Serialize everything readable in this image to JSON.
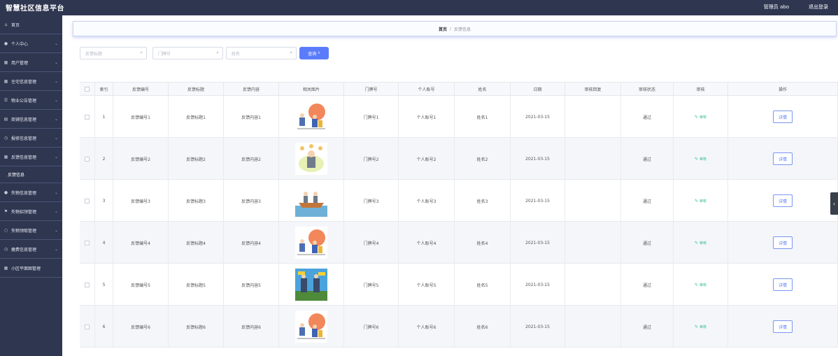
{
  "app": {
    "title": "智慧社区信息平台",
    "user_label": "管理员 abo",
    "logout_label": "退出登录"
  },
  "sidebar": {
    "items": [
      {
        "label": "首页",
        "icon": "home-icon",
        "glyph": "⌂"
      },
      {
        "label": "个人中心",
        "icon": "user-icon",
        "glyph": "●",
        "arrow": true
      },
      {
        "label": "用户管理",
        "icon": "grid-icon",
        "glyph": "▦",
        "arrow": true
      },
      {
        "label": "住宅信息管理",
        "icon": "grid-icon",
        "glyph": "▦",
        "arrow": true
      },
      {
        "label": "物业公告管理",
        "icon": "sliders-icon",
        "glyph": "☰",
        "arrow": true
      },
      {
        "label": "商铺信息管理",
        "icon": "building-icon",
        "glyph": "▤",
        "arrow": true
      },
      {
        "label": "报修信息管理",
        "icon": "clock-icon",
        "glyph": "◷",
        "arrow": true
      },
      {
        "label": "反馈信息管理",
        "icon": "grid-icon",
        "glyph": "▦",
        "arrow": true,
        "expanded": true
      },
      {
        "label": "反馈信息",
        "sub": true
      },
      {
        "label": "失物信息管理",
        "icon": "person-icon",
        "glyph": "●",
        "arrow": true
      },
      {
        "label": "失物招领管理",
        "icon": "flag-icon",
        "glyph": "⚑",
        "arrow": true
      },
      {
        "label": "失物领取管理",
        "icon": "circle-icon",
        "glyph": "○",
        "arrow": true
      },
      {
        "label": "缴费信息管理",
        "icon": "clock-icon",
        "glyph": "◷",
        "arrow": true
      },
      {
        "label": "小区平面图管理",
        "icon": "grid-icon",
        "glyph": "▦",
        "arrow": false
      }
    ]
  },
  "breadcrumb": {
    "home": "首页",
    "separator": "/",
    "current": "反馈信息"
  },
  "search": {
    "title_placeholder": "反馈标题",
    "door_placeholder": "门牌号",
    "name_placeholder": "姓名",
    "query_label": "查询"
  },
  "table": {
    "headers": [
      "索引",
      "反馈编号",
      "反馈标题",
      "反馈内容",
      "相关图片",
      "门牌号",
      "个人账号",
      "姓名",
      "日期",
      "审核回复",
      "审核状态",
      "审核",
      "操作"
    ],
    "approve_label": "审核",
    "detail_label": "详情",
    "rows": [
      {
        "index": "1",
        "code": "反馈编号1",
        "title": "反馈标题1",
        "content": "反馈内容1",
        "image": "cartoon-workers-orange",
        "door": "门牌号1",
        "account": "个人账号1",
        "name": "姓名1",
        "date": "2021-03-15",
        "reply": "",
        "status": "通过"
      },
      {
        "index": "2",
        "code": "反馈编号2",
        "title": "反馈标题2",
        "content": "反馈内容2",
        "image": "cartoon-man-money",
        "door": "门牌号2",
        "account": "个人账号2",
        "name": "姓名2",
        "date": "2021-03-15",
        "reply": "",
        "status": "通过"
      },
      {
        "index": "3",
        "code": "反馈编号3",
        "title": "反馈标题3",
        "content": "反馈内容3",
        "image": "cartoon-boat",
        "door": "门牌号3",
        "account": "个人账号3",
        "name": "姓名3",
        "date": "2021-03-15",
        "reply": "",
        "status": "通过"
      },
      {
        "index": "4",
        "code": "反馈编号4",
        "title": "反馈标题4",
        "content": "反馈内容4",
        "image": "cartoon-workers-orange",
        "door": "门牌号4",
        "account": "个人账号4",
        "name": "姓名4",
        "date": "2021-03-15",
        "reply": "",
        "status": "通过"
      },
      {
        "index": "5",
        "code": "反馈编号5",
        "title": "反馈标题5",
        "content": "反馈内容5",
        "image": "cartoon-signs-blue",
        "door": "门牌号5",
        "account": "个人账号5",
        "name": "姓名5",
        "date": "2021-03-15",
        "reply": "",
        "status": "通过"
      },
      {
        "index": "6",
        "code": "反馈编号6",
        "title": "反馈标题6",
        "content": "反馈内容6",
        "image": "cartoon-workers-orange",
        "door": "门牌号6",
        "account": "个人账号6",
        "name": "姓名6",
        "date": "2021-03-15",
        "reply": "",
        "status": "通过"
      }
    ]
  },
  "colors": {
    "sidebar_bg": "#2e3650",
    "accent": "#5b7cfa",
    "approve": "#2fbf8f"
  }
}
